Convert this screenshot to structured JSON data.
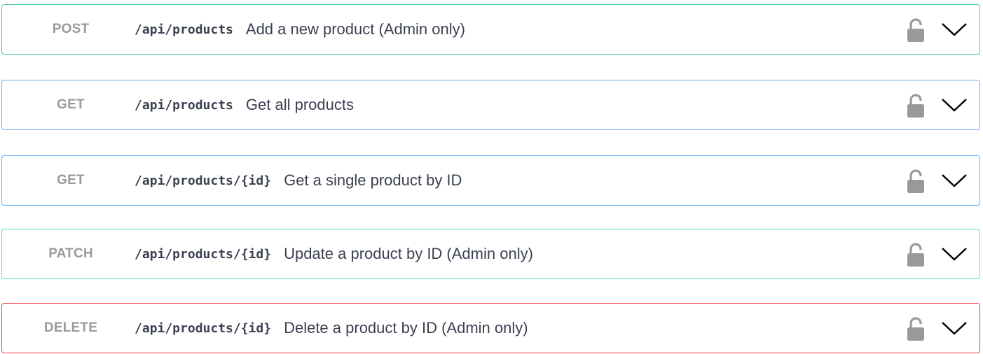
{
  "operations": [
    {
      "method": "POST",
      "path": "/api/products",
      "summary": "Add a new product (Admin only)",
      "color": "#49cc90"
    },
    {
      "method": "GET",
      "path": "/api/products",
      "summary": "Get all products",
      "color": "#61affe"
    },
    {
      "method": "GET",
      "path": "/api/products/{id}",
      "summary": "Get a single product by ID",
      "color": "#61affe"
    },
    {
      "method": "PATCH",
      "path": "/api/products/{id}",
      "summary": "Update a product by ID (Admin only)",
      "color": "#50e3c2"
    },
    {
      "method": "DELETE",
      "path": "/api/products/{id}",
      "summary": "Delete a product by ID (Admin only)",
      "color": "#f93e3e"
    }
  ],
  "icons": {
    "lock": "lock-icon",
    "expand": "chevron-down-icon"
  }
}
